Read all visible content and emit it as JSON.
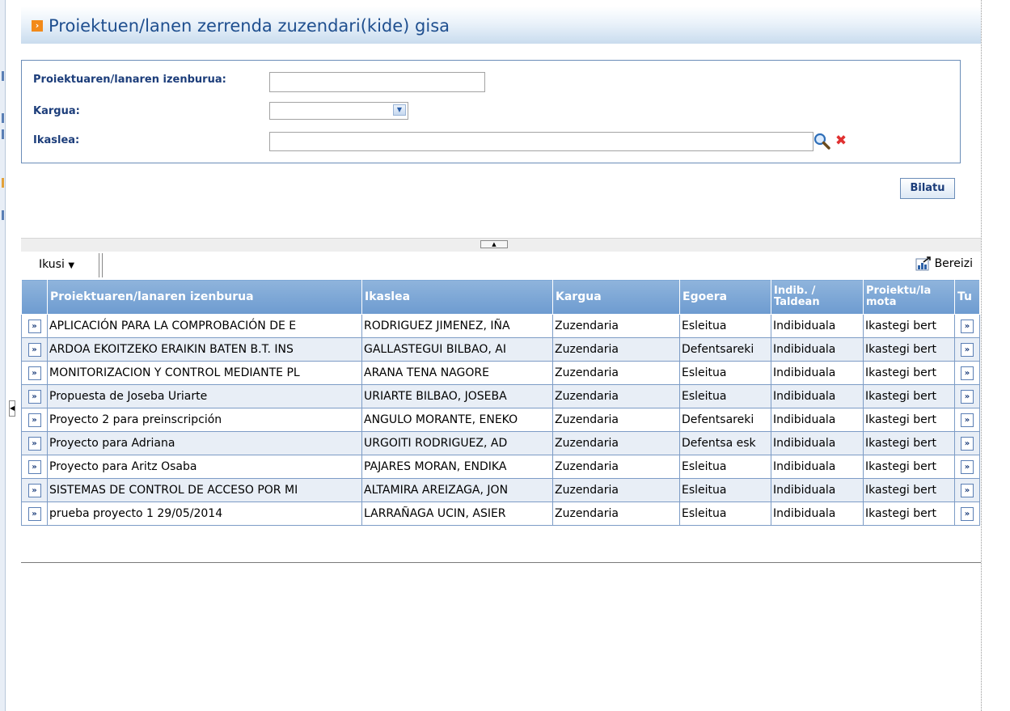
{
  "title": "Proiektuen/lanen zerrenda zuzendari(kide) gisa",
  "form": {
    "title_label": "Proiektuaren/lanaren izenburua:",
    "title_value": "",
    "kargua_label": "Kargua:",
    "kargua_value": "",
    "ikaslea_label": "Ikaslea:",
    "ikaslea_value": ""
  },
  "buttons": {
    "search": "Bilatu"
  },
  "toolbar": {
    "ikusi": "Ikusi",
    "bereizi": "Bereizi"
  },
  "table": {
    "columns": [
      "",
      "Proiektuaren/lanaren izenburua",
      "Ikaslea",
      "Kargua",
      "Egoera",
      "Indib. / Taldean",
      "Proiektu/la mota",
      "Tu"
    ],
    "rows": [
      {
        "title": "APLICACIÓN PARA LA COMPROBACIÓN DE E",
        "student": "RODRIGUEZ JIMENEZ, IÑA",
        "role": "Zuzendaria",
        "status": "Esleitua",
        "indib": "Indibiduala",
        "type": "Ikastegi bert"
      },
      {
        "title": "ARDOA EKOITZEKO ERAIKIN BATEN B.T. INS",
        "student": "GALLASTEGUI BILBAO, AI",
        "role": "Zuzendaria",
        "status": "Defentsareki",
        "indib": "Indibiduala",
        "type": "Ikastegi bert"
      },
      {
        "title": "MONITORIZACION Y CONTROL MEDIANTE PL",
        "student": "ARANA TENA NAGORE",
        "role": "Zuzendaria",
        "status": "Esleitua",
        "indib": "Indibiduala",
        "type": "Ikastegi bert"
      },
      {
        "title": "Propuesta de Joseba Uriarte",
        "student": "URIARTE BILBAO, JOSEBA",
        "role": "Zuzendaria",
        "status": "Esleitua",
        "indib": "Indibiduala",
        "type": "Ikastegi bert"
      },
      {
        "title": "Proyecto 2 para preinscripción",
        "student": "ANGULO MORANTE, ENEKO",
        "role": "Zuzendaria",
        "status": "Defentsareki",
        "indib": "Indibiduala",
        "type": "Ikastegi bert"
      },
      {
        "title": "Proyecto para Adriana",
        "student": "URGOITI RODRIGUEZ, AD",
        "role": "Zuzendaria",
        "status": "Defentsa esk",
        "indib": "Indibiduala",
        "type": "Ikastegi bert"
      },
      {
        "title": "Proyecto para Aritz Osaba",
        "student": "PAJARES MORAN, ENDIKA",
        "role": "Zuzendaria",
        "status": "Esleitua",
        "indib": "Indibiduala",
        "type": "Ikastegi bert"
      },
      {
        "title": "SISTEMAS DE CONTROL DE ACCESO POR MI",
        "student": "ALTAMIRA AREIZAGA, JON",
        "role": "Zuzendaria",
        "status": "Esleitua",
        "indib": "Indibiduala",
        "type": "Ikastegi bert"
      },
      {
        "title": "prueba proyecto 1 29/05/2014",
        "student": "LARRAÑAGA UCIN, ASIER",
        "role": "Zuzendaria",
        "status": "Esleitua",
        "indib": "Indibiduala",
        "type": "Ikastegi bert"
      }
    ],
    "row_button": "»"
  },
  "icons": {
    "title": "orange-arrow-icon",
    "search": "magnifier-icon",
    "clear": "red-x-icon",
    "bereizi": "export-chart-icon",
    "row": "double-chevron-icon"
  },
  "colors": {
    "title_text": "#1f4f8f",
    "header_bg": "#7aa6d6",
    "accent_orange": "#f28a1a",
    "clear_red": "#e03030"
  }
}
